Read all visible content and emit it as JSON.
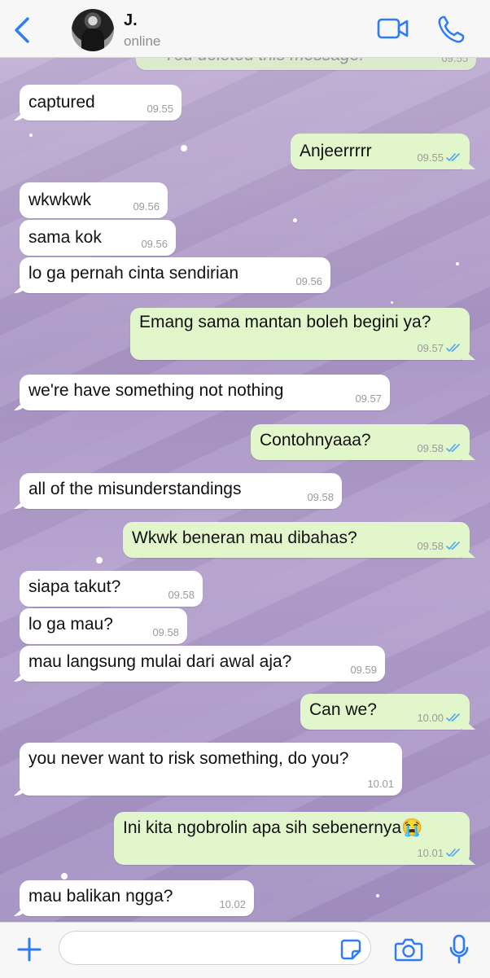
{
  "header": {
    "name": "J.",
    "status": "online"
  },
  "input": {
    "placeholder": ""
  },
  "colors": {
    "accent": "#2f7bf6",
    "incoming_bubble": "#ffffff",
    "outgoing_bubble": "#e1f6cb",
    "read_ticks": "#4fa6f0"
  },
  "messages": [
    {
      "dir": "out",
      "text": "You deleted this message.",
      "time": "09.55"
    },
    {
      "dir": "in",
      "text": "captured",
      "time": "09.55"
    },
    {
      "dir": "out",
      "text": "Anjeerrrrr",
      "time": "09.55"
    },
    {
      "dir": "in",
      "text": "wkwkwk",
      "time": "09.56"
    },
    {
      "dir": "in",
      "text": "sama kok",
      "time": "09.56"
    },
    {
      "dir": "in",
      "text": "lo ga pernah cinta sendirian",
      "time": "09.56"
    },
    {
      "dir": "out",
      "text": "Emang sama mantan boleh begini ya?",
      "time": "09.57"
    },
    {
      "dir": "in",
      "text": "we're have something not nothing",
      "time": "09.57"
    },
    {
      "dir": "out",
      "text": "Contohnyaaa?",
      "time": "09.58"
    },
    {
      "dir": "in",
      "text": "all of the misunderstandings",
      "time": "09.58"
    },
    {
      "dir": "out",
      "text": "Wkwk beneran mau dibahas?",
      "time": "09.58"
    },
    {
      "dir": "in",
      "text": "siapa takut?",
      "time": "09.58"
    },
    {
      "dir": "in",
      "text": "lo ga mau?",
      "time": "09.58"
    },
    {
      "dir": "in",
      "text": "mau langsung mulai dari awal aja?",
      "time": "09.59"
    },
    {
      "dir": "out",
      "text": "Can we?",
      "time": "10.00"
    },
    {
      "dir": "in",
      "text": "you never want to risk something, do you?",
      "time": "10.01"
    },
    {
      "dir": "out",
      "text": "Ini kita ngobrolin apa sih sebenernya😭",
      "time": "10.01"
    },
    {
      "dir": "in",
      "text": "mau balikan ngga?",
      "time": "10.02"
    }
  ]
}
